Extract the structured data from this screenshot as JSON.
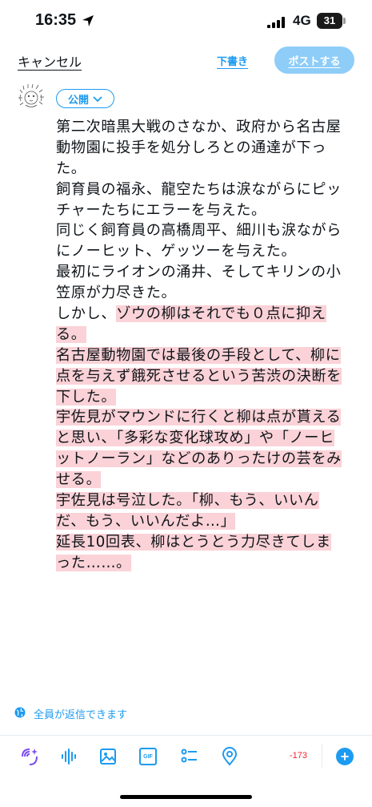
{
  "status_bar": {
    "time": "16:35",
    "network": "4G",
    "battery": "31"
  },
  "header": {
    "cancel_label": "キャンセル",
    "drafts_label": "下書き",
    "post_label": "ポストする"
  },
  "audience": {
    "label": "公開"
  },
  "post_lines": [
    {
      "segments": [
        {
          "text": "第二次暗黒大戦のさなか、政府から名古屋",
          "hl": false
        }
      ]
    },
    {
      "segments": [
        {
          "text": "動物園に投手を処分しろとの通達が下っ",
          "hl": false
        }
      ]
    },
    {
      "segments": [
        {
          "text": "た。",
          "hl": false
        }
      ]
    },
    {
      "segments": [
        {
          "text": "飼育員の福永、龍空たちは涙ながらにピッ",
          "hl": false
        }
      ]
    },
    {
      "segments": [
        {
          "text": "チャーたちにエラーを与えた。",
          "hl": false
        }
      ]
    },
    {
      "segments": [
        {
          "text": "同じく飼育員の高橋周平、細川も涙ながら",
          "hl": false
        }
      ]
    },
    {
      "segments": [
        {
          "text": "にノーヒット、ゲッツーを与えた。",
          "hl": false
        }
      ]
    },
    {
      "segments": [
        {
          "text": "最初にライオンの涌井、そしてキリンの小",
          "hl": false
        }
      ]
    },
    {
      "segments": [
        {
          "text": "笠原が力尽きた。",
          "hl": false
        }
      ]
    },
    {
      "segments": [
        {
          "text": "しかし、",
          "hl": false
        },
        {
          "text": "ゾウの柳はそれでも０点に抑え",
          "hl": true
        }
      ]
    },
    {
      "segments": [
        {
          "text": "る。",
          "hl": true
        }
      ]
    },
    {
      "segments": [
        {
          "text": "名古屋動物園では最後の手段として、柳に",
          "hl": true
        }
      ]
    },
    {
      "segments": [
        {
          "text": "点を与えず餓死させるという苦渋の決断を",
          "hl": true
        }
      ]
    },
    {
      "segments": [
        {
          "text": "下した。",
          "hl": true
        }
      ]
    },
    {
      "segments": [
        {
          "text": "宇佐見がマウンドに行くと柳は点が貰える",
          "hl": true
        }
      ]
    },
    {
      "segments": [
        {
          "text": "と思い、「多彩な変化球攻め」や「ノーヒ",
          "hl": true
        }
      ]
    },
    {
      "segments": [
        {
          "text": "ットノーラン」などのありったけの芸をみ",
          "hl": true
        }
      ]
    },
    {
      "segments": [
        {
          "text": "せる。",
          "hl": true
        }
      ]
    },
    {
      "segments": [
        {
          "text": "宇佐見は号泣した。「柳、もう、いいん",
          "hl": true
        }
      ]
    },
    {
      "segments": [
        {
          "text": "だ、もう、いいんだよ…」",
          "hl": true
        }
      ]
    },
    {
      "segments": [
        {
          "text": "延長10回表、柳はとうとう力尽きてしま",
          "hl": true
        }
      ]
    },
    {
      "segments": [
        {
          "text": "った……。",
          "hl": true
        }
      ]
    }
  ],
  "reply_setting": {
    "label": "全員が返信できます"
  },
  "toolbar": {
    "icons": [
      "ai-sparkle-icon",
      "audio-wave-icon",
      "image-icon",
      "gif-icon",
      "poll-icon",
      "location-icon"
    ],
    "gif_label": "GIF",
    "char_counter": "-173",
    "add_label": "+"
  },
  "colors": {
    "accent": "#1d9bf0",
    "highlight": "#fad2d7",
    "over_limit": "#f4212e",
    "disabled_post": "#8ecdf8"
  }
}
